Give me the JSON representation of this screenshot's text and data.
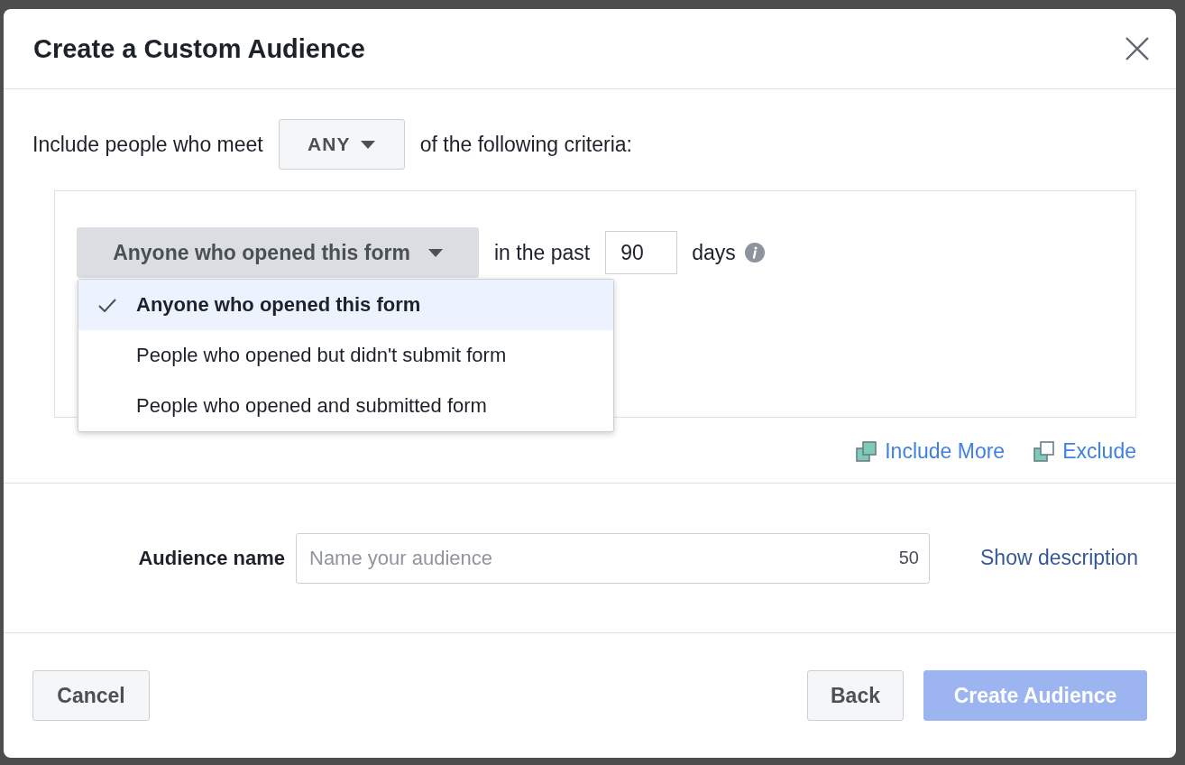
{
  "dialog": {
    "title": "Create a Custom Audience"
  },
  "criteria": {
    "prefix": "Include people who meet",
    "match": "ANY",
    "suffix": "of the following criteria:"
  },
  "rule": {
    "event": "Anyone who opened this form",
    "past_label": "in the past",
    "days": "90",
    "days_label": "days",
    "options": [
      {
        "label": "Anyone who opened this form",
        "selected": true
      },
      {
        "label": "People who opened but didn't submit form",
        "selected": false
      },
      {
        "label": "People who opened and submitted form",
        "selected": false
      }
    ]
  },
  "actions": [
    {
      "kind": "include",
      "label": "Include More"
    },
    {
      "kind": "exclude",
      "label": "Exclude"
    }
  ],
  "audience_name": {
    "label": "Audience name",
    "placeholder": "Name your audience",
    "counter": "50",
    "link": "Show description"
  },
  "footer": {
    "cancel": "Cancel",
    "back": "Back",
    "create": "Create Audience",
    "create_disabled": true
  }
}
